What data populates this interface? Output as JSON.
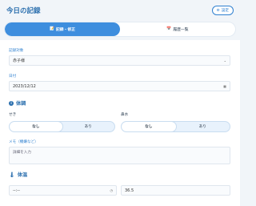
{
  "header": {
    "title": "今日の記録",
    "settings_label": "設定"
  },
  "tabs": [
    {
      "label": "記録・修正",
      "active": true
    },
    {
      "label": "履歴一覧",
      "active": false
    }
  ],
  "form": {
    "target_label": "記録対象",
    "target_value": "赤子様",
    "date_label": "日付",
    "date_value": "2023/12/12",
    "condition_heading": "体調",
    "cough_label": "せき",
    "cough_options": [
      "なし",
      "あり"
    ],
    "runny_nose_label": "鼻水",
    "runny_nose_options": [
      "なし",
      "あり"
    ],
    "memo_label": "メモ（機嫌など）",
    "memo_placeholder": "詳細を入力",
    "temp_heading": "体温",
    "time_value": "--:--",
    "temp_value": "36.5"
  },
  "colors": {
    "accent": "#2f80d0",
    "tab_active": "#3e8ede",
    "title": "#2b6fae"
  }
}
